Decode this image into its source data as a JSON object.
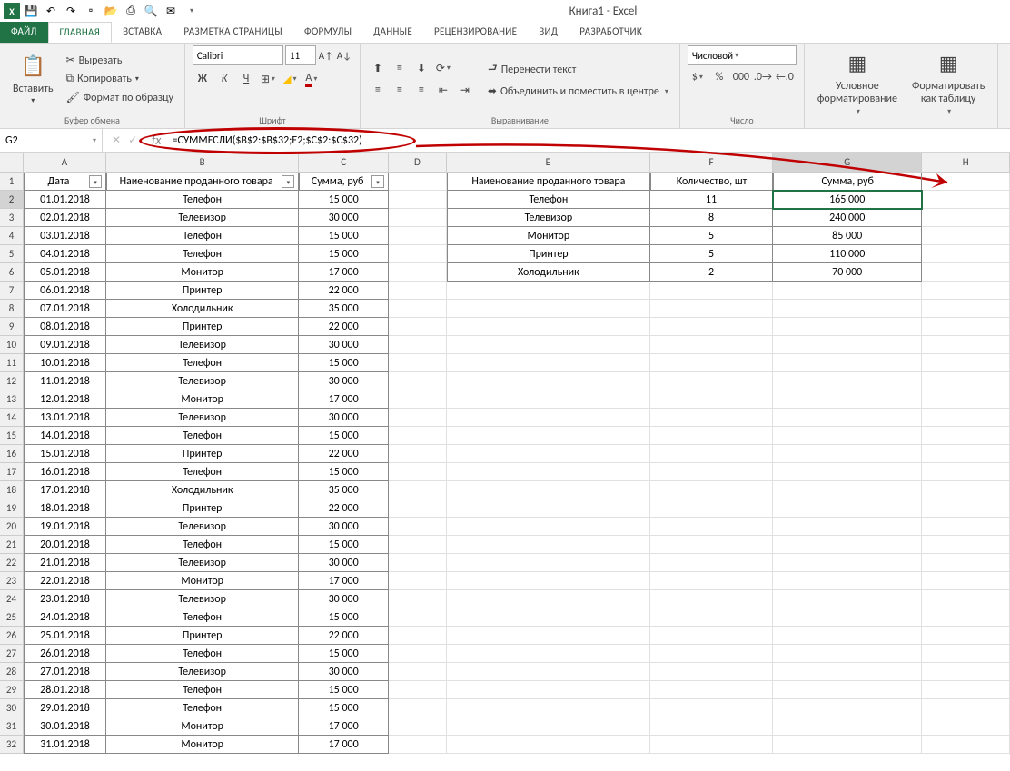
{
  "title": "Книга1 - Excel",
  "qat_icons": [
    "save",
    "undo",
    "redo",
    "new",
    "open",
    "quickprint",
    "preview",
    "spelling",
    "email",
    "more"
  ],
  "tabs": {
    "file": "ФАЙЛ",
    "home": "ГЛАВНАЯ",
    "insert": "ВСТАВКА",
    "layout": "РАЗМЕТКА СТРАНИЦЫ",
    "formulas": "ФОРМУЛЫ",
    "data": "ДАННЫЕ",
    "review": "РЕЦЕНЗИРОВАНИЕ",
    "view": "ВИД",
    "dev": "РАЗРАБОТЧИК"
  },
  "ribbon": {
    "clipboard": {
      "label": "Буфер обмена",
      "paste": "Вставить",
      "cut": "Вырезать",
      "copy": "Копировать",
      "painter": "Формат по образцу"
    },
    "font": {
      "label": "Шрифт",
      "name": "Calibri",
      "size": "11"
    },
    "align": {
      "label": "Выравнивание",
      "wrap": "Перенести текст",
      "merge": "Объединить и поместить в центре"
    },
    "number": {
      "label": "Число",
      "format": "Числовой"
    },
    "styles": {
      "cond": "Условное\nформатирование",
      "table": "Форматировать\nкак таблицу"
    }
  },
  "namebox": "G2",
  "formula": "=СУММЕСЛИ($B$2:$B$32;E2;$C$2:$C$32)",
  "cols": [
    "A",
    "B",
    "C",
    "D",
    "E",
    "F",
    "G",
    "H"
  ],
  "headers1": {
    "A": "Дата",
    "B": "Наиенование проданного товара",
    "C": "Сумма, руб"
  },
  "headers2": {
    "E": "Наиенование проданного товара",
    "F": "Количество, шт",
    "G": "Сумма, руб"
  },
  "table1": [
    {
      "d": "01.01.2018",
      "n": "Телефон",
      "s": "15 000"
    },
    {
      "d": "02.01.2018",
      "n": "Телевизор",
      "s": "30 000"
    },
    {
      "d": "03.01.2018",
      "n": "Телефон",
      "s": "15 000"
    },
    {
      "d": "04.01.2018",
      "n": "Телефон",
      "s": "15 000"
    },
    {
      "d": "05.01.2018",
      "n": "Монитор",
      "s": "17 000"
    },
    {
      "d": "06.01.2018",
      "n": "Принтер",
      "s": "22 000"
    },
    {
      "d": "07.01.2018",
      "n": "Холодильник",
      "s": "35 000"
    },
    {
      "d": "08.01.2018",
      "n": "Принтер",
      "s": "22 000"
    },
    {
      "d": "09.01.2018",
      "n": "Телевизор",
      "s": "30 000"
    },
    {
      "d": "10.01.2018",
      "n": "Телефон",
      "s": "15 000"
    },
    {
      "d": "11.01.2018",
      "n": "Телевизор",
      "s": "30 000"
    },
    {
      "d": "12.01.2018",
      "n": "Монитор",
      "s": "17 000"
    },
    {
      "d": "13.01.2018",
      "n": "Телевизор",
      "s": "30 000"
    },
    {
      "d": "14.01.2018",
      "n": "Телефон",
      "s": "15 000"
    },
    {
      "d": "15.01.2018",
      "n": "Принтер",
      "s": "22 000"
    },
    {
      "d": "16.01.2018",
      "n": "Телефон",
      "s": "15 000"
    },
    {
      "d": "17.01.2018",
      "n": "Холодильник",
      "s": "35 000"
    },
    {
      "d": "18.01.2018",
      "n": "Принтер",
      "s": "22 000"
    },
    {
      "d": "19.01.2018",
      "n": "Телевизор",
      "s": "30 000"
    },
    {
      "d": "20.01.2018",
      "n": "Телефон",
      "s": "15 000"
    },
    {
      "d": "21.01.2018",
      "n": "Телевизор",
      "s": "30 000"
    },
    {
      "d": "22.01.2018",
      "n": "Монитор",
      "s": "17 000"
    },
    {
      "d": "23.01.2018",
      "n": "Телевизор",
      "s": "30 000"
    },
    {
      "d": "24.01.2018",
      "n": "Телефон",
      "s": "15 000"
    },
    {
      "d": "25.01.2018",
      "n": "Принтер",
      "s": "22 000"
    },
    {
      "d": "26.01.2018",
      "n": "Телефон",
      "s": "15 000"
    },
    {
      "d": "27.01.2018",
      "n": "Телевизор",
      "s": "30 000"
    },
    {
      "d": "28.01.2018",
      "n": "Телефон",
      "s": "15 000"
    },
    {
      "d": "29.01.2018",
      "n": "Телефон",
      "s": "15 000"
    },
    {
      "d": "30.01.2018",
      "n": "Монитор",
      "s": "17 000"
    },
    {
      "d": "31.01.2018",
      "n": "Монитор",
      "s": "17 000"
    }
  ],
  "table2": [
    {
      "n": "Телефон",
      "q": "11",
      "s": "165 000"
    },
    {
      "n": "Телевизор",
      "q": "8",
      "s": "240 000"
    },
    {
      "n": "Монитор",
      "q": "5",
      "s": "85 000"
    },
    {
      "n": "Принтер",
      "q": "5",
      "s": "110 000"
    },
    {
      "n": "Холодильник",
      "q": "2",
      "s": "70 000"
    }
  ]
}
